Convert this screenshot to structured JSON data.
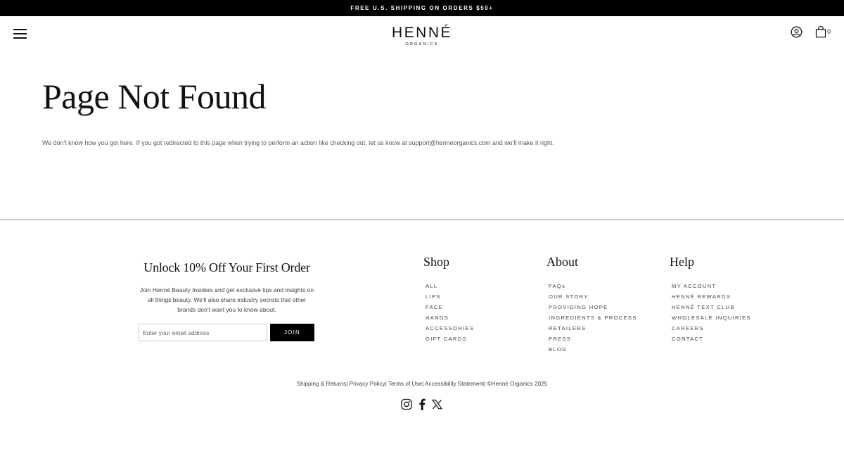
{
  "announcement": "FREE U.S. SHIPPING ON ORDERS $50+",
  "header": {
    "logo_main": "HENNÉ",
    "logo_sub": "ORGANICS",
    "cart_count": "0",
    "icons": [
      "menu-icon",
      "account-icon",
      "cart-icon"
    ]
  },
  "main": {
    "title": "Page Not Found",
    "message": "We don't know how you got here. If you got redirected to this page when trying to perform an action like checking out, let us know at support@henneorganics.com and we'll make it right."
  },
  "newsletter": {
    "title": "Unlock 10% Off Your First Order",
    "text": "Join Henné Beauty Insiders and get exclusive tips and insights on all things beauty. We'll also share industry secrets that other brands don't want you to know about.",
    "email_placeholder": "Enter your email address",
    "join_label": "JOIN"
  },
  "footer": {
    "shop": {
      "title": "Shop",
      "items": [
        "ALL",
        "LIPS",
        "FACE",
        "HANDS",
        "ACCESSORIES",
        "GIFT CARDS"
      ]
    },
    "about": {
      "title": "About",
      "items": [
        "FAQs",
        "OUR STORY",
        "PROVIDING HOPE",
        "INGREDIENTS & PROCESS",
        "RETAILERS",
        "PRESS",
        "BLOG"
      ]
    },
    "help": {
      "title": "Help",
      "items": [
        "MY ACCOUNT",
        "HENNÉ REWARDS",
        "HENNÉ TEXT CLUB",
        "WHOLESALE INQUIRIES",
        "CAREERS",
        "CONTACT"
      ]
    }
  },
  "legal": {
    "shipping": "Shipping & Returns",
    "privacy": "Privacy Policy",
    "terms": "Terms of Use",
    "accessibility": "Accessibility Statement",
    "copyright": "©Henné Organics 2025"
  },
  "socials": [
    "instagram-icon",
    "facebook-icon",
    "x-icon"
  ],
  "colors": {
    "announcement_bg": "#000000",
    "button_bg": "#000000",
    "text": "#222222",
    "divider": "#888888"
  }
}
